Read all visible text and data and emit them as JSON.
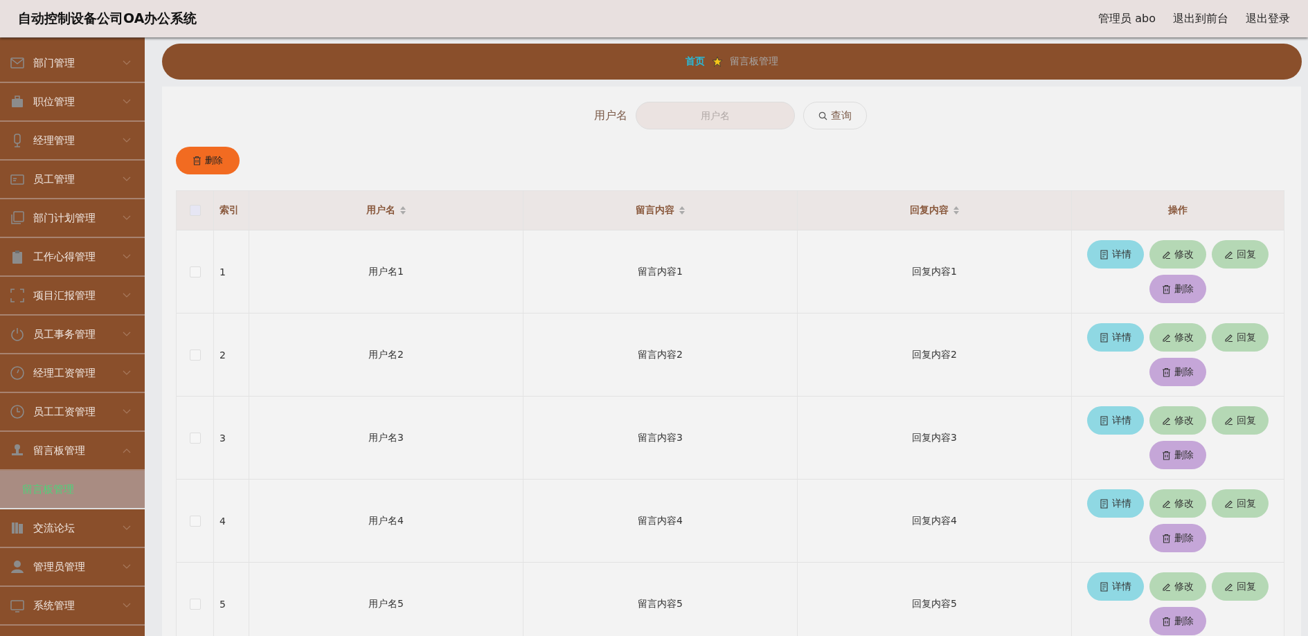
{
  "header": {
    "title": "自动控制设备公司OA办公系统",
    "links": [
      "管理员 abo",
      "退出到前台",
      "退出登录"
    ]
  },
  "sidebar": {
    "items": [
      {
        "label": "部门管理",
        "expanded": false
      },
      {
        "label": "职位管理",
        "expanded": false
      },
      {
        "label": "经理管理",
        "expanded": false
      },
      {
        "label": "员工管理",
        "expanded": false
      },
      {
        "label": "部门计划管理",
        "expanded": false
      },
      {
        "label": "工作心得管理",
        "expanded": false
      },
      {
        "label": "项目汇报管理",
        "expanded": false
      },
      {
        "label": "员工事务管理",
        "expanded": false
      },
      {
        "label": "经理工资管理",
        "expanded": false
      },
      {
        "label": "员工工资管理",
        "expanded": false
      },
      {
        "label": "留言板管理",
        "expanded": true,
        "children": [
          {
            "label": "留言板管理",
            "selected": true
          }
        ]
      },
      {
        "label": "交流论坛",
        "expanded": false
      },
      {
        "label": "管理员管理",
        "expanded": false
      },
      {
        "label": "系统管理",
        "expanded": false
      }
    ]
  },
  "breadcrumb": {
    "home": "首页",
    "current": "留言板管理"
  },
  "search": {
    "label": "用户名",
    "placeholder": "用户名",
    "button": "查询"
  },
  "delete_button": "删除",
  "table": {
    "all_checked": false,
    "columns": [
      {
        "label": "索引",
        "sortable": false
      },
      {
        "label": "用户名",
        "sortable": true
      },
      {
        "label": "留言内容",
        "sortable": true
      },
      {
        "label": "回复内容",
        "sortable": true
      },
      {
        "label": "操作",
        "sortable": false
      }
    ],
    "rows": [
      {
        "checked": false,
        "cells": [
          "1",
          "用户名1",
          "留言内容1",
          "回复内容1"
        ],
        "actions": [
          {
            "label": "详情",
            "kind": "detail"
          },
          {
            "label": "修改",
            "kind": "edit"
          },
          {
            "label": "回复",
            "kind": "reply"
          },
          {
            "label": "删除",
            "kind": "delete"
          }
        ]
      },
      {
        "checked": false,
        "cells": [
          "2",
          "用户名2",
          "留言内容2",
          "回复内容2"
        ],
        "actions": [
          {
            "label": "详情",
            "kind": "detail"
          },
          {
            "label": "修改",
            "kind": "edit"
          },
          {
            "label": "回复",
            "kind": "reply"
          },
          {
            "label": "删除",
            "kind": "delete"
          }
        ]
      },
      {
        "checked": false,
        "cells": [
          "3",
          "用户名3",
          "留言内容3",
          "回复内容3"
        ],
        "actions": [
          {
            "label": "详情",
            "kind": "detail"
          },
          {
            "label": "修改",
            "kind": "edit"
          },
          {
            "label": "回复",
            "kind": "reply"
          },
          {
            "label": "删除",
            "kind": "delete"
          }
        ]
      },
      {
        "checked": false,
        "cells": [
          "4",
          "用户名4",
          "留言内容4",
          "回复内容4"
        ],
        "actions": [
          {
            "label": "详情",
            "kind": "detail"
          },
          {
            "label": "修改",
            "kind": "edit"
          },
          {
            "label": "回复",
            "kind": "reply"
          },
          {
            "label": "删除",
            "kind": "delete"
          }
        ]
      },
      {
        "checked": false,
        "cells": [
          "5",
          "用户名5",
          "留言内容5",
          "回复内容5"
        ],
        "actions": [
          {
            "label": "详情",
            "kind": "detail"
          },
          {
            "label": "修改",
            "kind": "edit"
          },
          {
            "label": "回复",
            "kind": "reply"
          },
          {
            "label": "删除",
            "kind": "delete"
          }
        ]
      }
    ]
  }
}
